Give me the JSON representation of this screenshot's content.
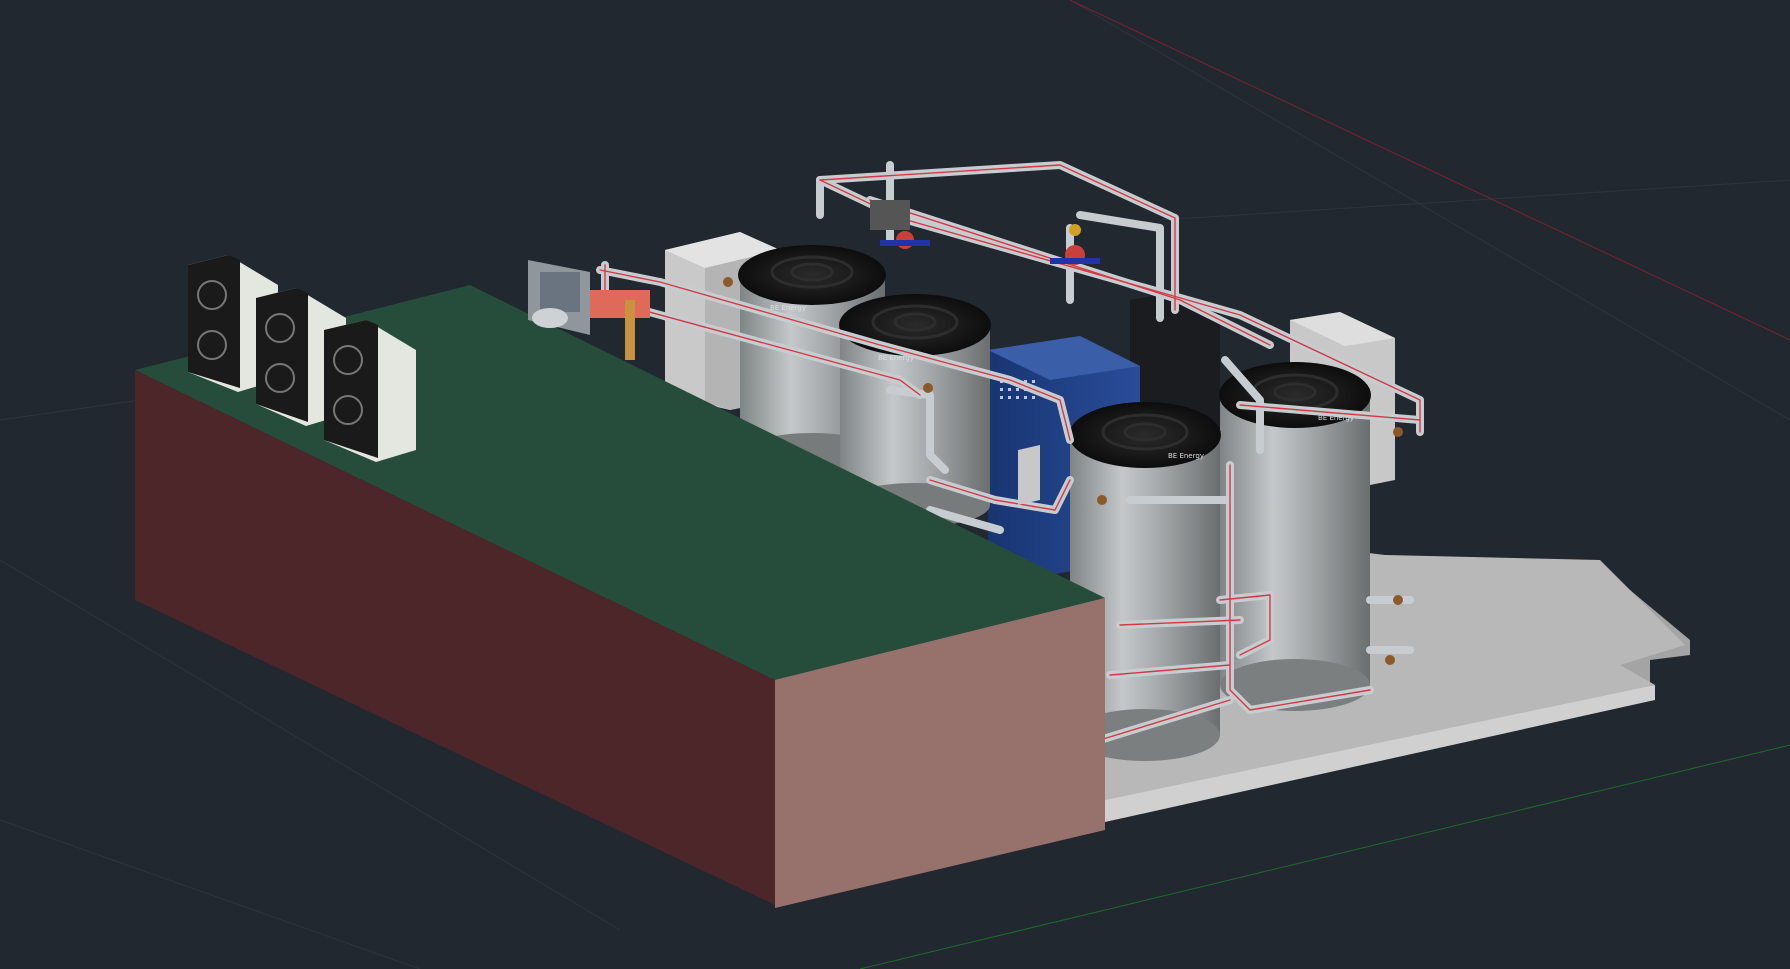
{
  "viewport": {
    "background": "#212830",
    "grid_line_color": "#2b333c",
    "x_axis_color": "#8a2020",
    "y_axis_color": "#1f6a2a"
  },
  "model": {
    "building_roof_color": "#254c3a",
    "building_roof_edge_color": "#4f8a6a",
    "building_front_color": "#98706a",
    "building_side_color": "#4c2527",
    "slab_color": "#9e9e9e",
    "slab_top_color": "#b6b6b6",
    "tank_color": "#9ea2a3",
    "tank_lid_color": "#1a1a1a",
    "pipe_color": "#c9ced2",
    "pipe_stripe_color": "#d0303a",
    "cabinet_color": "#1f3f86",
    "outdoor_unit_color": "#e6e8e2",
    "tank_badges": [
      "BE Energy",
      "BE Energy",
      "BE Energy",
      "BE Energy"
    ]
  }
}
